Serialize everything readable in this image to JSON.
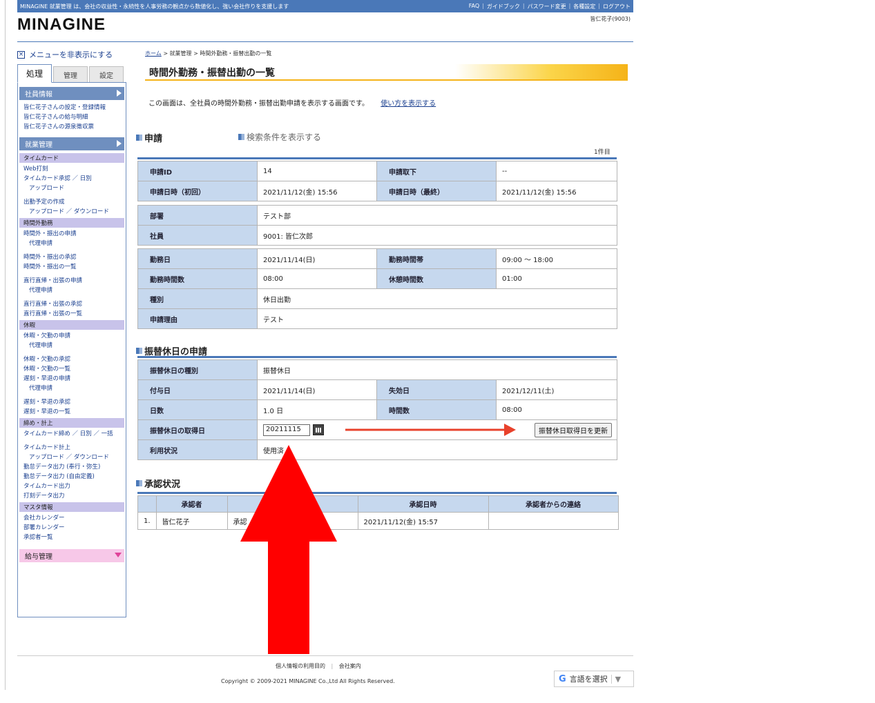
{
  "header": {
    "tagline": "MINAGINE 就業管理 は、会社の収益性・永続性を人事労務の観点から数値化し、強い会社作りを支援します",
    "nav": [
      "FAQ",
      "ガイドブック",
      "パスワード変更",
      "各種設定",
      "ログアウト"
    ],
    "user": "皆仁花子(9003)",
    "logo": "MINAGINE"
  },
  "sidebar": {
    "hide_menu": "メニューを非表示にする",
    "tabs": [
      "処理",
      "管理",
      "設定"
    ],
    "sections": [
      {
        "title": "社員情報",
        "links": [
          "皆仁花子さんの設定・登録情報",
          "皆仁花子さんの給与明細",
          "皆仁花子さんの源泉徴収票"
        ]
      },
      {
        "title": "就業管理",
        "groups": [
          {
            "sub": "タイムカード",
            "links": [
              "Web打刻",
              "タイムカード承認 ／ 日別",
              "アップロード",
              "出勤予定の作成",
              "アップロード ／ ダウンロード"
            ]
          },
          {
            "sub": "時間外勤務",
            "links": [
              "時間外・振出の申請",
              "代理申請",
              "時間外・振出の承認",
              "時間外・振出の一覧",
              "直行直帰・出張の申請",
              "代理申請",
              "直行直帰・出張の承認",
              "直行直帰・出張の一覧"
            ]
          },
          {
            "sub": "休暇",
            "links": [
              "休暇・欠勤の申請",
              "代理申請",
              "休暇・欠勤の承認",
              "休暇・欠勤の一覧",
              "遅刻・早退の申請",
              "代理申請",
              "遅刻・早退の承認",
              "遅刻・早退の一覧"
            ]
          },
          {
            "sub": "締め・計上",
            "links": [
              "タイムカード締め ／ 日別 ／ 一括",
              "タイムカード計上",
              "アップロード ／ ダウンロード",
              "勤怠データ出力 (奉行・弥生)",
              "勤怠データ出力 (自由定義)",
              "タイムカード出力",
              "打刻データ出力"
            ]
          },
          {
            "sub": "マスタ情報",
            "links": [
              "会社カレンダー",
              "部署カレンダー",
              "承認者一覧"
            ]
          }
        ]
      },
      {
        "title": "給与管理"
      }
    ]
  },
  "breadcrumb": {
    "home": "ホーム",
    "sep": ">",
    "b1": "就業管理",
    "b2": "時間外勤務・振替出勤の一覧"
  },
  "page": {
    "title": "時間外勤務・振替出勤の一覧",
    "desc": "この画面は、全社員の時間外勤務・振替出勤申請を表示する画面です。",
    "howto": "使い方を表示する",
    "sec_apply": "申請",
    "show_cond": "検索条件を表示する",
    "count": "1件目",
    "sec_sub": "振替休日の申請",
    "sec_approval": "承認状況"
  },
  "apply": {
    "id_label": "申請ID",
    "id": "14",
    "cancel_label": "申請取下",
    "cancel": "--",
    "date_first_label": "申請日時（初回）",
    "date_first": "2021/11/12(金) 15:56",
    "date_last_label": "申請日時（最終）",
    "date_last": "2021/11/12(金) 15:56",
    "dept_label": "部署",
    "dept": "テスト部",
    "emp_label": "社員",
    "emp": "9001: 皆仁次郎",
    "work_label": "勤務日",
    "work": "2021/11/14(日)",
    "band_label": "勤務時間帯",
    "band": "09:00 ～ 18:00",
    "hours_label": "勤務時間数",
    "hours": "08:00",
    "rest_label": "休憩時間数",
    "rest": "01:00",
    "type_label": "種別",
    "type": "休日出勤",
    "reason_label": "申請理由",
    "reason": "テスト"
  },
  "sub": {
    "kind_label": "振替休日の種別",
    "kind": "振替休日",
    "grant_label": "付与日",
    "grant": "2021/11/14(日)",
    "exp_label": "失効日",
    "exp": "2021/12/11(土)",
    "days_label": "日数",
    "days": "1.0 日",
    "hrs_label": "時間数",
    "hrs": "08:00",
    "take_label": "振替休日の取得日",
    "take": "20211115",
    "update_btn": "振替休日取得日を更新",
    "usage_label": "利用状況",
    "usage": "使用済"
  },
  "approval": {
    "headers": [
      "承認者",
      "",
      "承認日時",
      "承認者からの連絡"
    ],
    "rows": [
      {
        "no": "1.",
        "name": "皆仁花子",
        "status": "承認",
        "date": "2021/11/12(金) 15:57",
        "note": ""
      }
    ]
  },
  "footer": {
    "privacy": "個人情報の利用目的",
    "sep": "|",
    "company": "会社案内",
    "copyright": "Copyright © 2009-2021 MINAGINE Co.,Ltd All Rights Reserved.",
    "translate": "言語を選択",
    "g": "G",
    "caret": "▼"
  },
  "annotation": {
    "arrow_color": "#ff0000",
    "pointer_color": "#e8412b"
  }
}
